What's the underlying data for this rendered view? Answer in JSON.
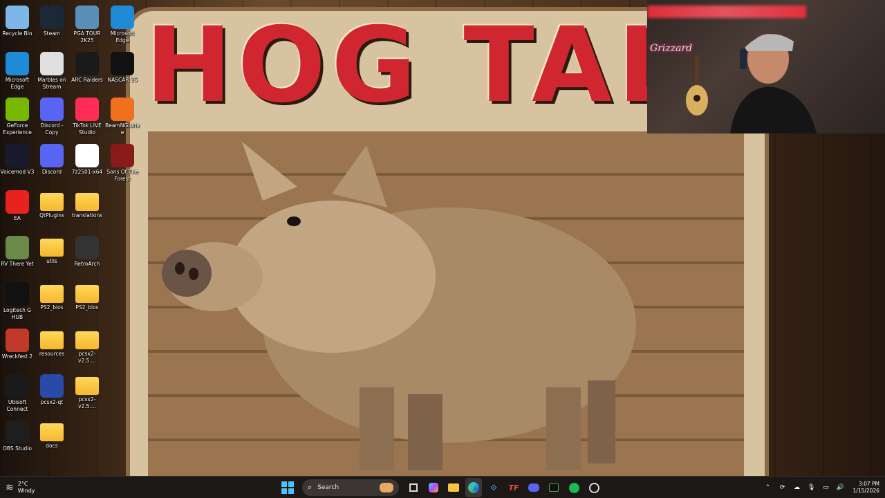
{
  "desktop": {
    "icons": [
      {
        "label": "Recycle Bin",
        "icon": "recycle-bin-icon",
        "color": "#7fb6e8"
      },
      {
        "label": "Steam",
        "icon": "steam-icon",
        "color": "#1b2838"
      },
      {
        "label": "PGA TOUR 2K25",
        "icon": "pga-tour-icon",
        "color": "#5a8fb8"
      },
      {
        "label": "Microsoft Edge",
        "icon": "edge-icon",
        "color": "#1f8ad6"
      },
      {
        "label": "Microsoft Edge",
        "icon": "edge-icon",
        "color": "#1f8ad6"
      },
      {
        "label": "Marbles on Stream",
        "icon": "marbles-icon",
        "color": "#e0e0e0"
      },
      {
        "label": "ARC Raiders",
        "icon": "arc-raiders-icon",
        "color": "#1a1a1a"
      },
      {
        "label": "GeForce Experience",
        "icon": "geforce-icon",
        "color": "#76b900"
      },
      {
        "label": "Discord - Copy",
        "icon": "discord-icon",
        "color": "#5865f2"
      },
      {
        "label": "TikTok LIVE Studio",
        "icon": "tiktok-icon",
        "color": "#ff2d55"
      },
      {
        "label": "NASCAR 25",
        "icon": "nascar-icon",
        "color": "#111111"
      },
      {
        "label": "Voicemod V3",
        "icon": "voicemod-icon",
        "color": "#1a1a2e"
      },
      {
        "label": "Discord",
        "icon": "discord-icon",
        "color": "#5865f2"
      },
      {
        "label": "7z2501-x64",
        "icon": "sevenzip-icon",
        "color": "#ffffff"
      },
      {
        "label": "BeamNG.drive",
        "icon": "beamng-icon",
        "color": "#f07020"
      },
      {
        "label": "EA",
        "icon": "ea-icon",
        "color": "#e8231e"
      },
      {
        "label": "QtPlugins",
        "icon": "folder-icon",
        "color": "#f5b82e"
      },
      {
        "label": "translations",
        "icon": "folder-icon",
        "color": "#f5b82e"
      },
      {
        "label": "Sons Of The Forest",
        "icon": "sons-of-the-forest-icon",
        "color": "#8a1a1a"
      },
      {
        "label": "RV There Yet",
        "icon": "rv-there-yet-icon",
        "color": "#6a8a4a"
      },
      {
        "label": "utils",
        "icon": "folder-icon",
        "color": "#f5b82e"
      },
      {
        "label": "RetroArch",
        "icon": "retroarch-icon",
        "color": "#333333"
      },
      {
        "label": "Logitech G HUB",
        "icon": "logitech-icon",
        "color": "#111111"
      },
      {
        "label": "PS2_bios",
        "icon": "folder-icon",
        "color": "#f5b82e"
      },
      {
        "label": "PS2_bios",
        "icon": "folder-icon",
        "color": "#f5b82e"
      },
      {
        "label": "Wreckfest 2",
        "icon": "wreckfest-icon",
        "color": "#c0392b"
      },
      {
        "label": "resources",
        "icon": "folder-icon",
        "color": "#f5b82e"
      },
      {
        "label": "pcsx2-v2.5....",
        "icon": "folder-icon",
        "color": "#f5b82e"
      },
      {
        "label": "Ubisoft Connect",
        "icon": "ubisoft-icon",
        "color": "#1a1a1a"
      },
      {
        "label": "pcsx2-qt",
        "icon": "pcsx2-icon",
        "color": "#2a4aa8"
      },
      {
        "label": "pcsx2-v2.5....",
        "icon": "folder-icon",
        "color": "#f5b82e"
      },
      {
        "label": "OBS Studio",
        "icon": "obs-icon",
        "color": "#1e1e1e"
      },
      {
        "label": "docs",
        "icon": "folder-icon",
        "color": "#f5b82e"
      }
    ]
  },
  "wallpaper": {
    "sign_text": "HOG TALK",
    "accent": "#d02630"
  },
  "webcam": {
    "neon_sign": "Grizzard"
  },
  "taskbar": {
    "weather_temp": "2°C",
    "weather_condition": "Windy",
    "search_placeholder": "Search",
    "apps": [
      "start-icon",
      "task-view-icon",
      "copilot-icon",
      "file-explorer-icon",
      "edge-icon",
      "app-icon",
      "tf-icon",
      "discord-icon",
      "terminal-icon",
      "spotify-icon",
      "obs-icon"
    ],
    "time": "3:07 PM",
    "date": "1/15/2026"
  }
}
